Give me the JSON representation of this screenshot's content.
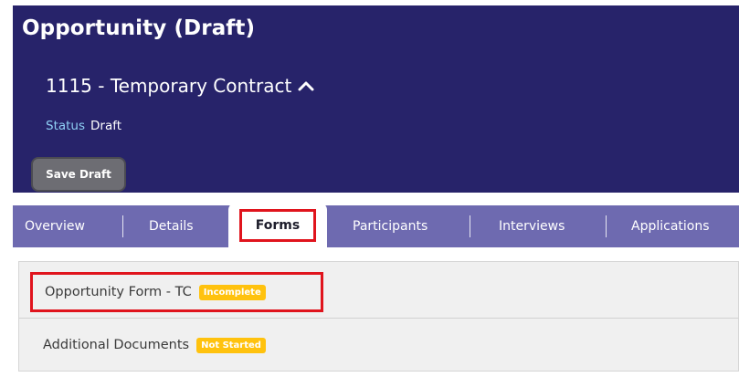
{
  "header": {
    "page_title": "Opportunity (Draft)",
    "record_title": "1115 - Temporary Contract",
    "status_label": "Status",
    "status_value": "Draft",
    "save_label": "Save Draft"
  },
  "tabs": [
    {
      "label": "Overview"
    },
    {
      "label": "Details"
    },
    {
      "label": "Forms",
      "active": true
    },
    {
      "label": "Participants"
    },
    {
      "label": "Interviews"
    },
    {
      "label": "Applications"
    }
  ],
  "forms": [
    {
      "name": "Opportunity Form - TC",
      "status": "Incomplete"
    },
    {
      "name": "Additional Documents",
      "status": "Not Started"
    }
  ],
  "colors": {
    "header_bg": "#27236a",
    "tab_bar_bg": "#6e6ab0",
    "badge_bg": "#ffc20e",
    "highlight": "#e0141d",
    "status_label": "#8fd0f5"
  }
}
